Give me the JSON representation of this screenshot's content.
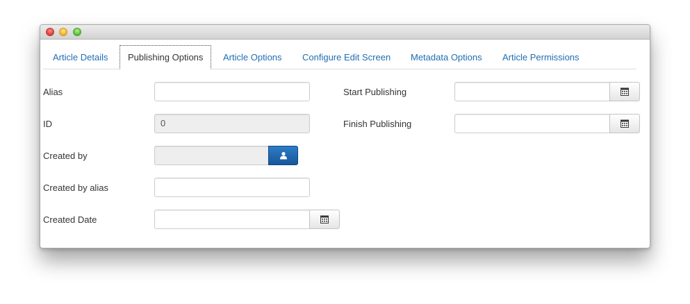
{
  "tabs": [
    {
      "label": "Article Details"
    },
    {
      "label": "Publishing Options"
    },
    {
      "label": "Article Options"
    },
    {
      "label": "Configure Edit Screen"
    },
    {
      "label": "Metadata Options"
    },
    {
      "label": "Article Permissions"
    }
  ],
  "active_tab": "Publishing Options",
  "fields": {
    "alias": {
      "label": "Alias",
      "value": ""
    },
    "id": {
      "label": "ID",
      "value": "0"
    },
    "created_by": {
      "label": "Created by",
      "value": "",
      "button_icon": "user-icon"
    },
    "created_by_alias": {
      "label": "Created by alias",
      "value": ""
    },
    "created_date": {
      "label": "Created Date",
      "value": "",
      "button_icon": "calendar-icon"
    },
    "start_publishing": {
      "label": "Start Publishing",
      "value": "",
      "button_icon": "calendar-icon"
    },
    "finish_publishing": {
      "label": "Finish Publishing",
      "value": "",
      "button_icon": "calendar-icon"
    }
  },
  "colors": {
    "link": "#1f6db2",
    "primary_button": "#17569c",
    "readonly_bg": "#eeeeee"
  }
}
